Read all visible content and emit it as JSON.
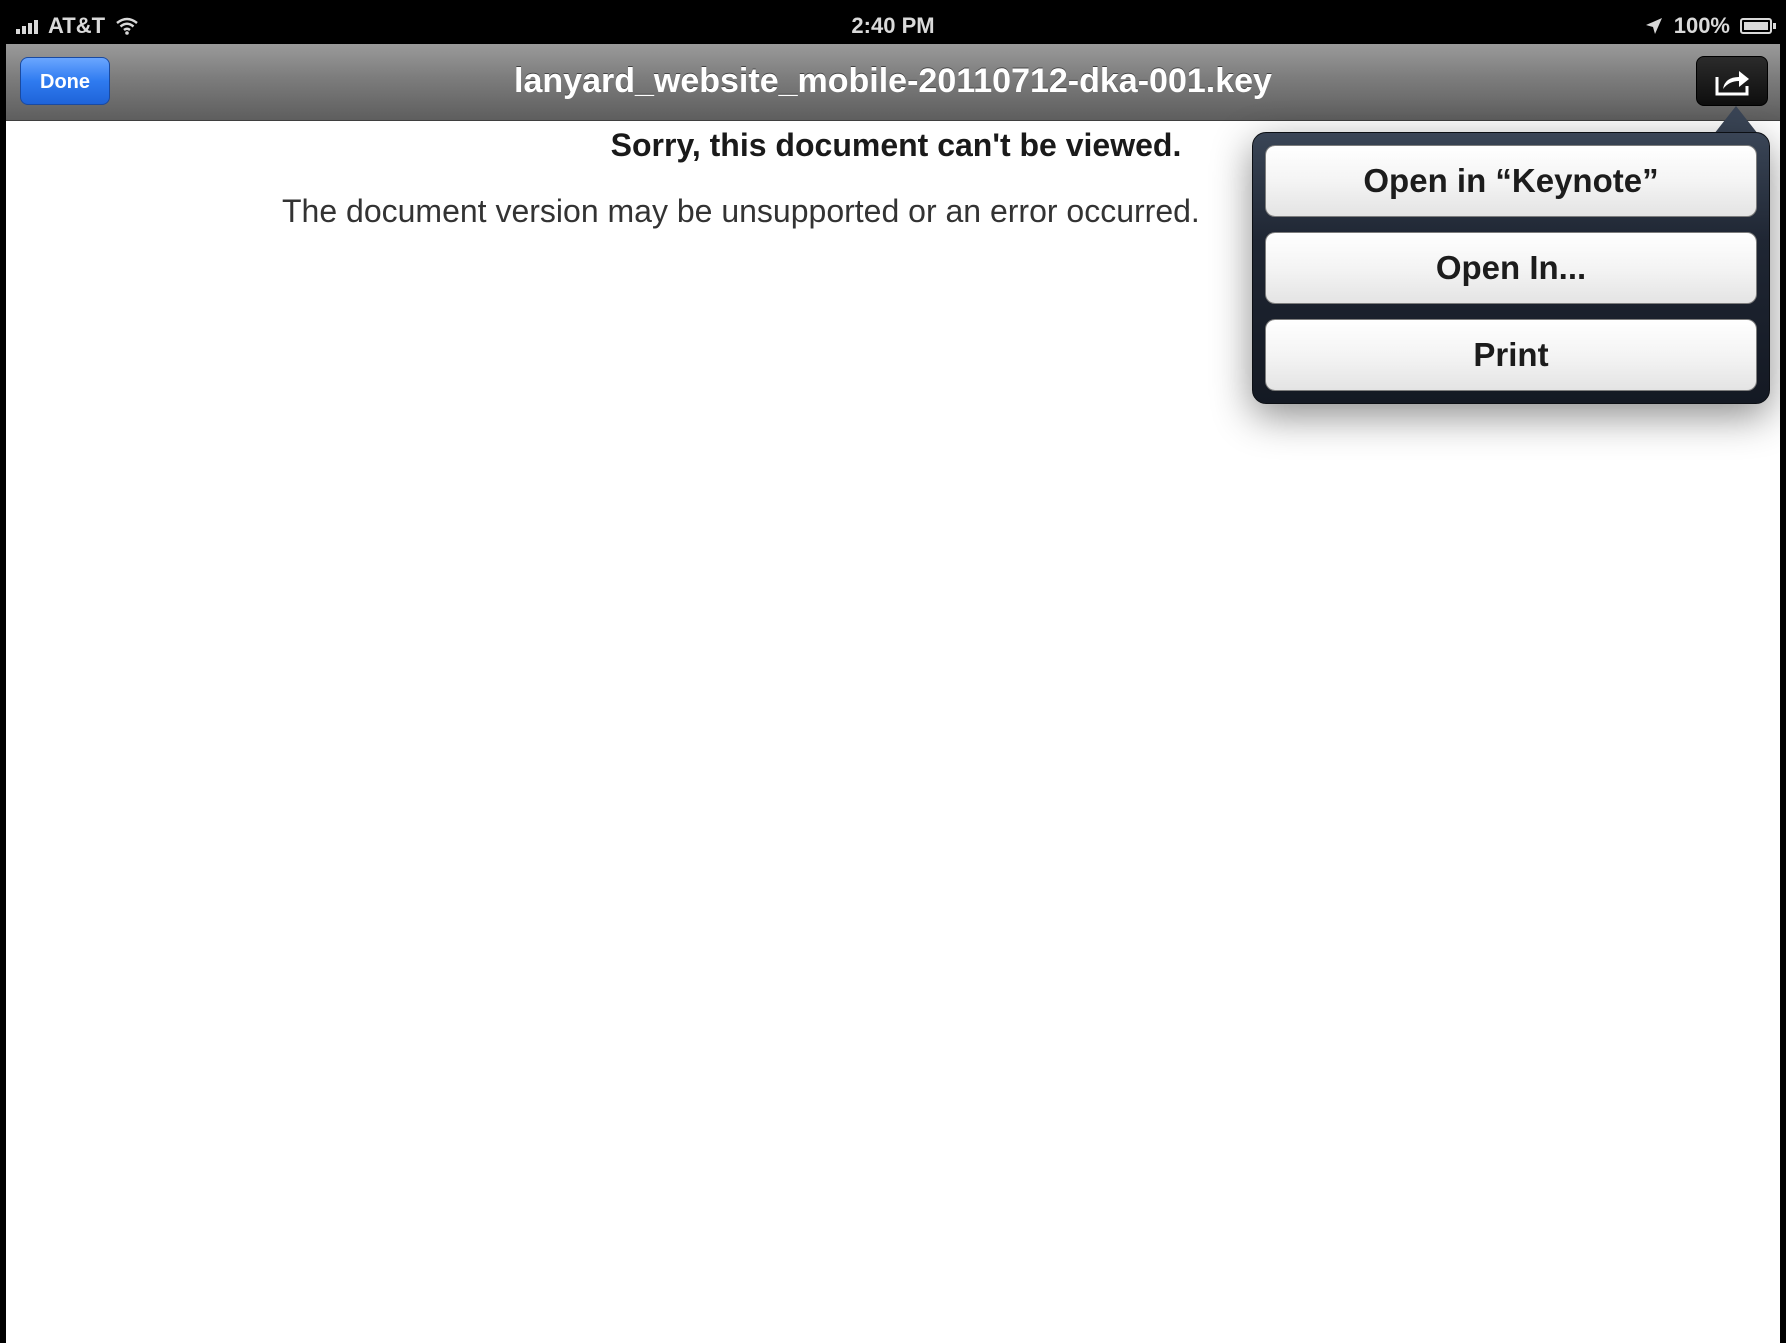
{
  "status_bar": {
    "carrier": "AT&T",
    "time": "2:40 PM",
    "battery": "100%",
    "signal_icon": "signal-bars-icon",
    "wifi_icon": "wifi-icon",
    "location_icon": "location-arrow-icon",
    "battery_icon": "battery-full-icon"
  },
  "nav_bar": {
    "done_label": "Done",
    "title": "lanyard_website_mobile-20110712-dka-001.key",
    "share_icon": "share-icon",
    "done_color": "#2f7bf0"
  },
  "content": {
    "error_title": "Sorry, this document can't be viewed.",
    "error_message": "The document version may be unsupported or an error occurred."
  },
  "popover": {
    "items": [
      {
        "label": "Open in “Keynote”"
      },
      {
        "label": "Open In..."
      },
      {
        "label": "Print"
      }
    ]
  }
}
